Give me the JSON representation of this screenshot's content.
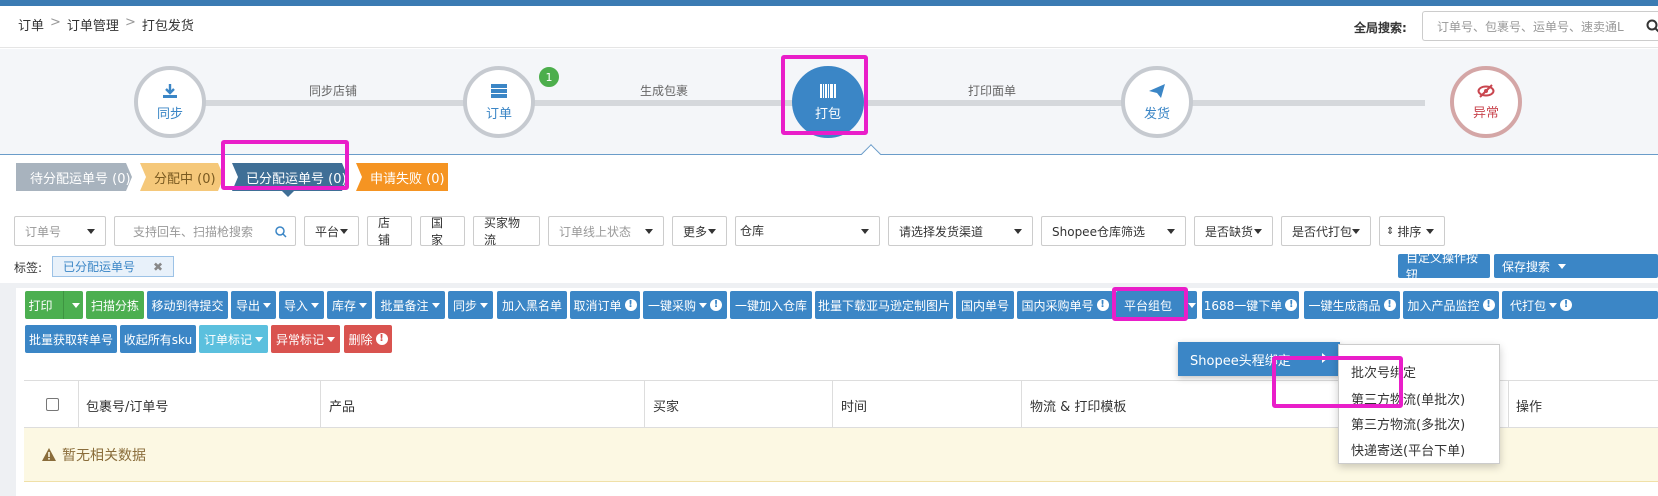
{
  "breadcrumb": {
    "items": [
      "订单",
      "订单管理",
      "打包发货"
    ],
    "sep": ">"
  },
  "search": {
    "label": "全局搜索:",
    "placeholder": "订单号、包裹号、运单号、速卖通L"
  },
  "steps": [
    {
      "label": "同步",
      "icon": "download-icon"
    },
    {
      "label": "订单",
      "icon": "server-icon",
      "badge": "1"
    },
    {
      "label": "打包",
      "icon": "barcode-icon",
      "active": true
    },
    {
      "label": "发货",
      "icon": "paper-plane-icon"
    },
    {
      "label": "异常",
      "icon": "eye-slash-icon"
    }
  ],
  "step_links": [
    "同步店铺",
    "生成包裹",
    "打印面单"
  ],
  "tabs": [
    {
      "label": "待分配运单号 (0)",
      "color": "#a8b3be"
    },
    {
      "label": "分配中 (0)",
      "color": "#f5c87a"
    },
    {
      "label": "已分配运单号 (0)",
      "color": "#3f6f96"
    },
    {
      "label": "申请失败 (0)",
      "color": "#f59422"
    }
  ],
  "filters": {
    "order_no": "订单号",
    "scan_placeholder": "支持回车、扫描枪搜索",
    "platform": "平台",
    "shop": "店铺",
    "country": "国家",
    "buyer_logistics": "买家物流",
    "online_status": "订单线上状态",
    "more": "更多",
    "warehouse": "仓库",
    "channel": "请选择发货渠道",
    "shopee_wh": "Shopee仓库筛选",
    "missing": "是否缺货",
    "proxy_pack": "是否代打包",
    "sort": "排序"
  },
  "tag": {
    "label": "标签:",
    "value": "已分配运单号",
    "close": "✖"
  },
  "right_buttons": {
    "custom": "自定义操作按钮",
    "save": "保存搜索"
  },
  "toolbar1": [
    "打印",
    "扫描分拣",
    "移动到待提交",
    "导出",
    "导入",
    "库存",
    "批量备注",
    "同步",
    "加入黑名单",
    "取消订单",
    "一键采购",
    "一键加入仓库",
    "批量下载亚马逊定制图片",
    "国内单号",
    "国内采购单号",
    "平台组包",
    "1688一键下单",
    "一键生成商品",
    "加入产品监控",
    "代打包"
  ],
  "toolbar2": [
    "批量获取转单号",
    "收起所有sku",
    "订单标记",
    "异常标记",
    "删除"
  ],
  "table": {
    "headers": [
      "包裹号/订单号",
      "产品",
      "买家",
      "时间",
      "物流 & 打印模板",
      "操作"
    ],
    "empty": "暂无相关数据"
  },
  "menu": {
    "item": "Shopee头程绑定",
    "sub": [
      "批次号绑定",
      "第三方物流(单批次)",
      "第三方物流(多批次)",
      "快递寄送(平台下单)"
    ]
  },
  "colors": {
    "primary": "#3b86c6",
    "success": "#4caf50",
    "danger": "#d9534f",
    "highlight": "#e91ec9"
  }
}
